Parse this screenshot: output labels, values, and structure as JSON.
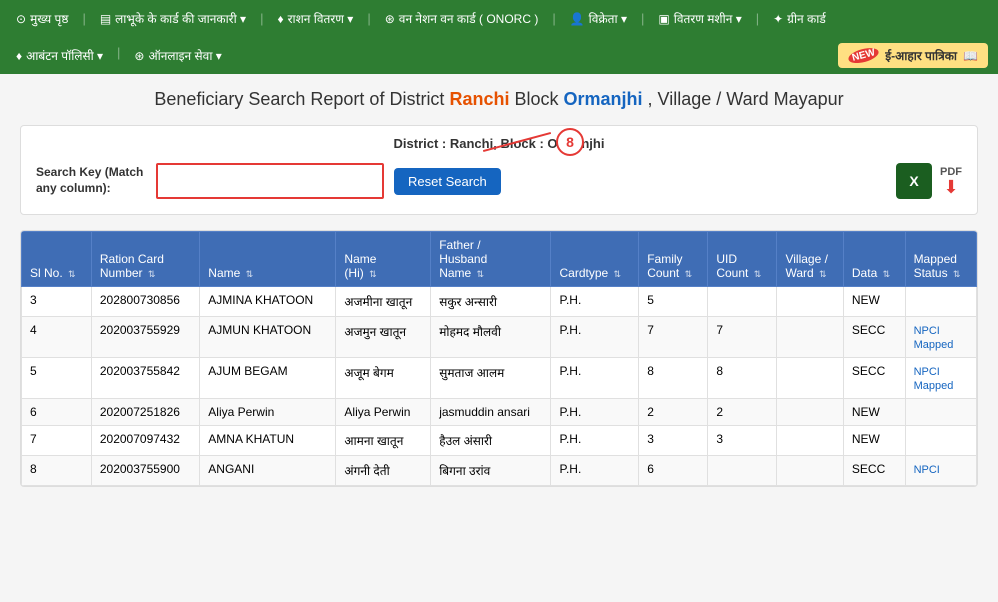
{
  "nav": {
    "top_items": [
      {
        "label": "मुख्य पृष्ठ",
        "icon": "home"
      },
      {
        "label": "लाभूके के कार्ड की जानकारी ▾",
        "icon": "card"
      },
      {
        "label": "राशन वितरण ▾",
        "icon": "ration"
      },
      {
        "label": "वन नेशन वन कार्ड ( ONORC )",
        "icon": "onorc"
      },
      {
        "label": "विक्रेता ▾",
        "icon": "seller"
      },
      {
        "label": "वितरण मशीन ▾",
        "icon": "machine"
      },
      {
        "label": "ग्रीन कार्ड",
        "icon": "green-card"
      }
    ],
    "second_items": [
      {
        "label": "आबंटन पॉलिसी ▾",
        "icon": "policy"
      },
      {
        "label": "ऑनलाइन सेवा ▾",
        "icon": "online"
      }
    ],
    "eaahar_label": "ई-आहार पात्रिका",
    "new_badge": "NEW"
  },
  "page": {
    "title_prefix": "Beneficiary Search Report of District",
    "district": "Ranchi",
    "block_label": "Block",
    "block": "Ormanjhi",
    "village_label": ", Village / Ward",
    "village": "Mayapur"
  },
  "search_panel": {
    "district_info": "District : Ranchi, Block : Ormanjhi",
    "search_label": "Search Key (Match any column):",
    "search_placeholder": "",
    "reset_button": "Reset Search",
    "annotation_number": "8",
    "excel_label": "X",
    "pdf_label": "PDF"
  },
  "table": {
    "headers": [
      {
        "label": "Sl No.",
        "key": "sl_no"
      },
      {
        "label": "Ration Card Number",
        "key": "ration_card"
      },
      {
        "label": "Name",
        "key": "name"
      },
      {
        "label": "Name (Hi)",
        "key": "name_hi"
      },
      {
        "label": "Father / Husband Name",
        "key": "father_name"
      },
      {
        "label": "Cardtype",
        "key": "cardtype"
      },
      {
        "label": "Family Count",
        "key": "family_count"
      },
      {
        "label": "UID Count",
        "key": "uid_count"
      },
      {
        "label": "Village / Ward",
        "key": "village"
      },
      {
        "label": "Data",
        "key": "data"
      },
      {
        "label": "Mapped Status",
        "key": "mapped_status"
      }
    ],
    "rows": [
      {
        "sl_no": "3",
        "ration_card": "202800730856",
        "name": "AJMINA KHATOON",
        "name_hi": "अजमीना खातून",
        "father_name": "सकुर अन्सारी",
        "cardtype": "P.H.",
        "family_count": "5",
        "uid_count": "",
        "village": "",
        "data": "NEW",
        "mapped_status": ""
      },
      {
        "sl_no": "4",
        "ration_card": "202003755929",
        "name": "AJMUN KHATOON",
        "name_hi": "अजमुन खातून",
        "father_name": "मोहमद मौलवी",
        "cardtype": "P.H.",
        "family_count": "7",
        "uid_count": "7",
        "village": "",
        "data": "SECC",
        "mapped_status": "NPCI Mapped"
      },
      {
        "sl_no": "5",
        "ration_card": "202003755842",
        "name": "AJUM BEGAM",
        "name_hi": "अजूम बेगम",
        "father_name": "सुमताज आलम",
        "cardtype": "P.H.",
        "family_count": "8",
        "uid_count": "8",
        "village": "",
        "data": "SECC",
        "mapped_status": "NPCI Mapped"
      },
      {
        "sl_no": "6",
        "ration_card": "202007251826",
        "name": "Aliya Perwin",
        "name_hi": "Aliya Perwin",
        "father_name": "jasmuddin ansari",
        "cardtype": "P.H.",
        "family_count": "2",
        "uid_count": "2",
        "village": "",
        "data": "NEW",
        "mapped_status": ""
      },
      {
        "sl_no": "7",
        "ration_card": "202007097432",
        "name": "AMNA KHATUN",
        "name_hi": "आमना खातून",
        "father_name": "हैउल अंसारी",
        "cardtype": "P.H.",
        "family_count": "3",
        "uid_count": "3",
        "village": "",
        "data": "NEW",
        "mapped_status": ""
      },
      {
        "sl_no": "8",
        "ration_card": "202003755900",
        "name": "ANGANI",
        "name_hi": "अंगनी देती",
        "father_name": "बिगना उरांव",
        "cardtype": "P.H.",
        "family_count": "6",
        "uid_count": "",
        "village": "",
        "data": "SECC",
        "mapped_status": "NPCI"
      }
    ]
  },
  "colors": {
    "nav_bg": "#2e7d32",
    "header_bg": "#3f6db5",
    "accent_red": "#e53935",
    "accent_orange": "#e65100",
    "accent_blue": "#1565c0"
  }
}
